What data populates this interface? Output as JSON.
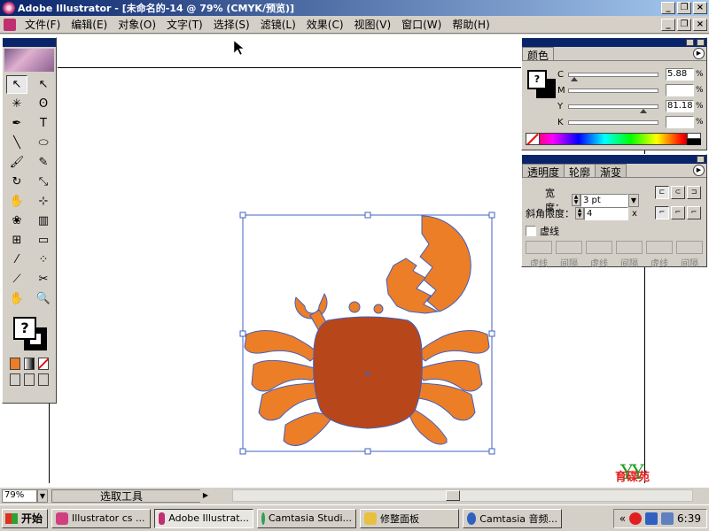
{
  "window": {
    "title": "Adobe Illustrator - [未命名的-14 @ 79% (CMYK/预览)]",
    "minimize": "_",
    "restore": "❐",
    "close": "×"
  },
  "menu": {
    "items": [
      "文件(F)",
      "编辑(E)",
      "对象(O)",
      "文字(T)",
      "选择(S)",
      "滤镜(L)",
      "效果(C)",
      "视图(V)",
      "窗口(W)",
      "帮助(H)"
    ]
  },
  "toolbox": {
    "tools": [
      {
        "name": "selection-tool",
        "glyph": "↖"
      },
      {
        "name": "direct-selection-tool",
        "glyph": "↖"
      },
      {
        "name": "magic-wand-tool",
        "glyph": "✳"
      },
      {
        "name": "lasso-tool",
        "glyph": "ʘ"
      },
      {
        "name": "pen-tool",
        "glyph": "✒"
      },
      {
        "name": "type-tool",
        "glyph": "T"
      },
      {
        "name": "line-tool",
        "glyph": "╲"
      },
      {
        "name": "ellipse-tool",
        "glyph": "⬭"
      },
      {
        "name": "paintbrush-tool",
        "glyph": "🖌"
      },
      {
        "name": "pencil-tool",
        "glyph": "✎"
      },
      {
        "name": "rotate-tool",
        "glyph": "↻"
      },
      {
        "name": "scale-tool",
        "glyph": "⤡"
      },
      {
        "name": "warp-tool",
        "glyph": "✋"
      },
      {
        "name": "free-transform-tool",
        "glyph": "⊹"
      },
      {
        "name": "symbol-sprayer-tool",
        "glyph": "❀"
      },
      {
        "name": "column-graph-tool",
        "glyph": "▥"
      },
      {
        "name": "mesh-tool",
        "glyph": "⊞"
      },
      {
        "name": "gradient-tool",
        "glyph": "▭"
      },
      {
        "name": "eyedropper-tool",
        "glyph": "⁄"
      },
      {
        "name": "blend-tool",
        "glyph": "⁘"
      },
      {
        "name": "slice-tool",
        "glyph": "⟋"
      },
      {
        "name": "scissors-tool",
        "glyph": "✂"
      },
      {
        "name": "hand-tool",
        "glyph": "✋"
      },
      {
        "name": "zoom-tool",
        "glyph": "🔍"
      }
    ],
    "fill_glyph": "?"
  },
  "color_panel": {
    "tab": "颜色",
    "channels": [
      {
        "label": "C",
        "value": "5.88",
        "pos": 0.06
      },
      {
        "label": "M",
        "value": "",
        "pos": null
      },
      {
        "label": "Y",
        "value": "81.18",
        "pos": 0.81
      },
      {
        "label": "K",
        "value": "",
        "pos": null
      }
    ],
    "unit": "%",
    "fill_glyph": "?"
  },
  "stroke_panel": {
    "tabs": [
      "透明度",
      "轮廓",
      "渐变"
    ],
    "weight_label": "宽度：",
    "weight_value": "3 pt",
    "miter_label": "斜角限度：",
    "miter_value": "4",
    "miter_unit": "x",
    "dashed_label": "虚线",
    "dash_labels": [
      "虚线",
      "间隔",
      "虚线",
      "间隔",
      "虚线",
      "间隔"
    ]
  },
  "statusbar": {
    "zoom": "79%",
    "tool": "选取工具"
  },
  "taskbar": {
    "start": "开始",
    "buttons": [
      {
        "label": "Illustrator cs ...",
        "color": "#d04080",
        "active": false
      },
      {
        "label": "Adobe Illustrat...",
        "color": "#c03070",
        "active": true
      },
      {
        "label": "Camtasia Studi...",
        "color": "#30a050",
        "active": false
      },
      {
        "label": "修整面板",
        "color": "#e8c040",
        "active": false
      },
      {
        "label": "Camtasia 音频...",
        "color": "#3060c0",
        "active": false
      }
    ],
    "clock": "6:39"
  },
  "watermark": "育碟苑",
  "colors": {
    "crab_body": "#b7461a",
    "crab_limb": "#ec7e28",
    "selection": "#4060c0"
  }
}
